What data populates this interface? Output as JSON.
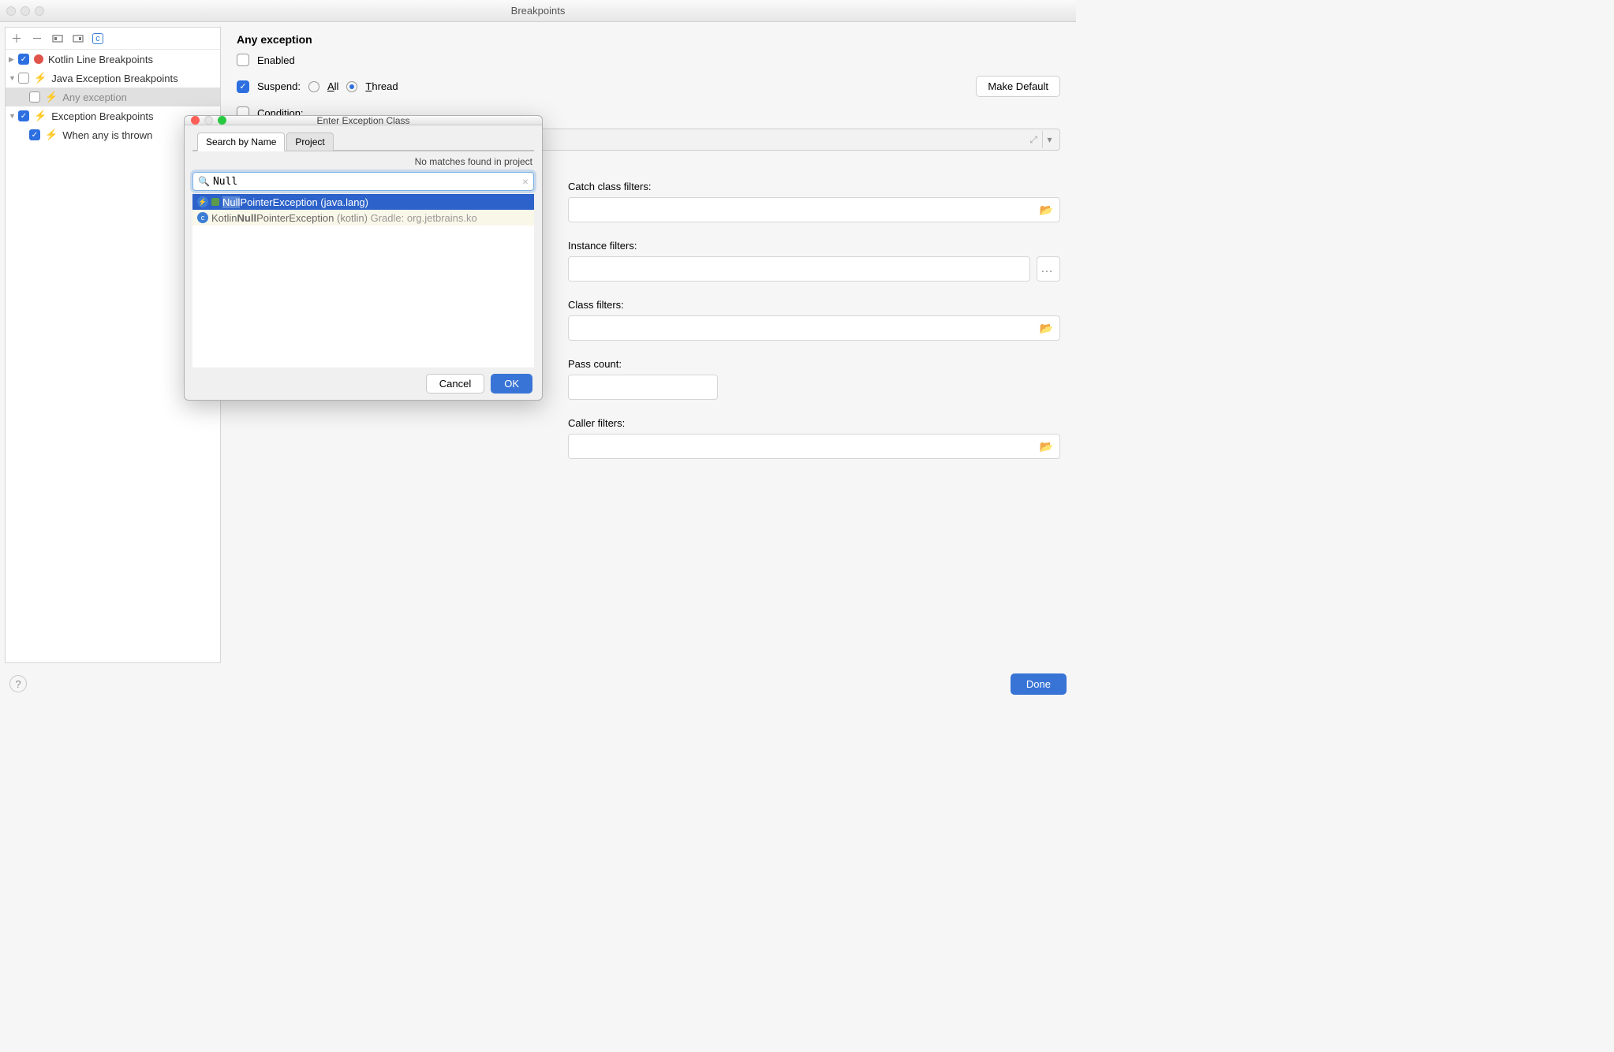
{
  "window": {
    "title": "Breakpoints"
  },
  "tree": {
    "groups": [
      {
        "label": "Kotlin Line Breakpoints",
        "checked": true,
        "kind": "dot",
        "expanded": true
      },
      {
        "label": "Java Exception Breakpoints",
        "checked": false,
        "kind": "bolt",
        "expanded": true,
        "children": [
          {
            "label": "Any exception",
            "checked": false,
            "selected": true,
            "kind": "bolt-dim"
          }
        ]
      },
      {
        "label": "Exception Breakpoints",
        "checked": true,
        "kind": "bolt",
        "expanded": true,
        "children": [
          {
            "label": "When any is thrown",
            "checked": true,
            "selected": false,
            "kind": "bolt"
          }
        ]
      }
    ]
  },
  "panel": {
    "heading": "Any exception",
    "enabled_label": "Enabled",
    "enabled_checked": false,
    "suspend_label": "Suspend:",
    "suspend_checked": true,
    "radio_all": "All",
    "radio_thread": "Thread",
    "radio_selected": "thread",
    "make_default": "Make Default",
    "condition_label": "Condition:",
    "filters": {
      "catch": "Catch class filters:",
      "instance": "Instance filters:",
      "class": "Class filters:",
      "pass": "Pass count:",
      "caller": "Caller filters:"
    }
  },
  "footer": {
    "done": "Done"
  },
  "dialog": {
    "title": "Enter Exception Class",
    "tabs": {
      "name": "Search by Name",
      "project": "Project"
    },
    "status": "No matches found in project",
    "search_value": "Null",
    "results": [
      {
        "highlight": "Null",
        "rest": "PointerException",
        "suffix": " (java.lang)",
        "selected": true
      },
      {
        "highlight": "Null",
        "rest": "PointerException",
        "prefix": "Kotlin",
        "suffix": " (kotlin)",
        "tail": " Gradle: org.jetbrains.ko",
        "selected": false
      }
    ],
    "cancel": "Cancel",
    "ok": "OK"
  }
}
